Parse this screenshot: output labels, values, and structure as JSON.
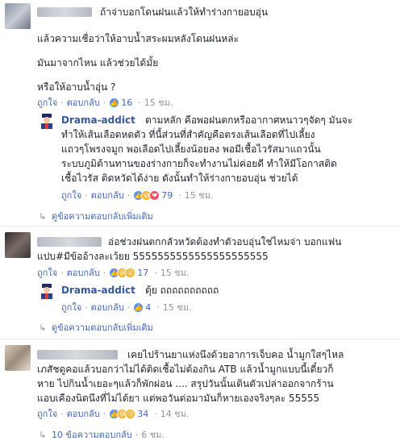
{
  "comments": [
    {
      "lines": [
        "ถ้าจ่าบอกโดนฝนแล้วให้ทำร่างกายอบอุ่น",
        "แล้วความเชื่อว่าให้อาบน้ำสระผมหลังโดนฝนหล่ะ",
        "มันมาจากไหน แล้วช่วยได้มั้ย",
        "หรือให้อาบน้ำอุ่น ?"
      ],
      "like": "ถูกใจ",
      "reply": "ตอบกลับ",
      "reaction_count": "16",
      "time": "15 ชม."
    },
    {
      "name": "Drama-addict",
      "lines": [
        "ตามหลัก คือพอฝนตกหรืออากาศหนาวๆจัดๆ มันจะ",
        "ทำให้เส้นเลือดหดตัว ที่นี้ส่วนที่สำคัญคือตรงเส้นเลือดที่ไปเลี้ยง",
        "แถวๆโพรงจมูก พอเลือดไปเลี้ยงน้อยลง พอมีเชื้อไวรัสมาแถวนั้น",
        "ระบบภูมิต้านทานของร่างกายก็จะทำงานไม่ค่อยดี ทำให้มีโอกาสติด",
        "เชื้อไวรัส ติดหวัดได้ง่าย ดังนั้นทำให้ร่างกายอบอุ่น ช่วยได้"
      ],
      "like": "ถูกใจ",
      "reply": "ตอบกลับ",
      "reaction_count": "79",
      "time": "15 ชม."
    },
    {
      "view_more": "ดูข้อความตอบกลับเพิ่มเติม"
    },
    {
      "lines": [
        "อ่อช่วงฝนตกกลัวหวัดต้องทำตัวอบอุ่นใช่ไหมจ่า บอกแฟน",
        "แปบ#มีข้ออ้างละเว้ยย 5555555555555555555555"
      ],
      "like": "ถูกใจ",
      "reply": "ตอบกลับ",
      "reaction_count": "17",
      "time": "15 ชม."
    },
    {
      "name": "Drama-addict",
      "lines": [
        "ตุ้ย ถถถถถถถถถถ"
      ],
      "like": "ถูกใจ",
      "reply": "ตอบกลับ",
      "reaction_count": "4",
      "time": "15 ชม."
    },
    {
      "view_more": "ดูข้อความตอบกลับเพิ่มเติม"
    },
    {
      "lines": [
        "เคยไปร้านยาแห่งนึงด้วยอาการเจ็บคอ น้ำมูกใสๆไหล",
        "เภสัชดูคอแล้วบอกว่าไม่ได้ติดเชื้อไม่ต้องกิน ATB แล้วน้ำมูกแบบนี้เดี๋ยวก็",
        "หาย ไปกินน้ำเยอะๆแล้วก็พักผ่อน .... สรุปวันนั้นเดินตัวเปล่าออกจากร้าน",
        "แอบเคืองนิดนึงที่ไม่ได้ยา แต่พอวันต่อมามันก็หายเองจริงๆละ 55555"
      ],
      "like": "ถูกใจ",
      "reply": "ตอบกลับ",
      "reaction_count": "34",
      "time": "14 ชม."
    },
    {
      "view_more": "10 ข้อความตอบกลับ",
      "time": "6 ชม."
    }
  ],
  "colors": {
    "link": "#365899",
    "meta": "#90949c",
    "like_blue": "#5890ff"
  }
}
